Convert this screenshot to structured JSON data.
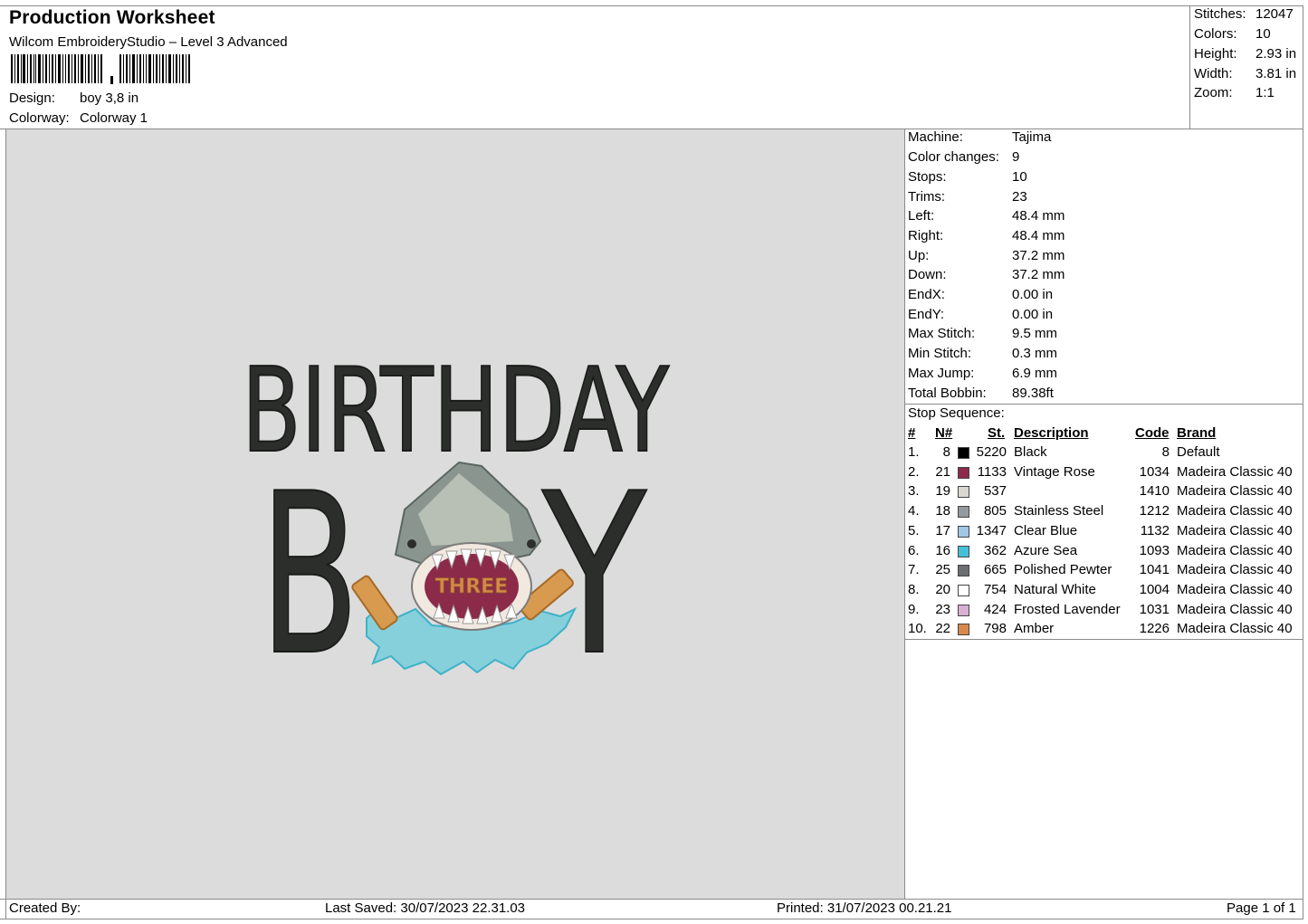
{
  "header": {
    "title": "Production Worksheet",
    "software": "Wilcom EmbroideryStudio – Level 3 Advanced",
    "design_label": "Design:",
    "design_value": "boy 3,8 in",
    "colorway_label": "Colorway:",
    "colorway_value": "Colorway 1"
  },
  "summary": [
    {
      "label": "Stitches:",
      "value": "12047"
    },
    {
      "label": "Colors:",
      "value": "10"
    },
    {
      "label": "Height:",
      "value": "2.93 in"
    },
    {
      "label": "Width:",
      "value": "3.81 in"
    },
    {
      "label": "Zoom:",
      "value": "1:1"
    }
  ],
  "design_preview": {
    "line1": "BIRTHDAY",
    "line2_left": "B",
    "line2_right": "Y",
    "inner_text": "THREE"
  },
  "machine_info": [
    {
      "label": "Machine:",
      "value": "Tajima"
    },
    {
      "label": "Color changes:",
      "value": "9"
    },
    {
      "label": "Stops:",
      "value": "10"
    },
    {
      "label": "Trims:",
      "value": "23"
    },
    {
      "label": "Left:",
      "value": "48.4 mm"
    },
    {
      "label": "Right:",
      "value": "48.4 mm"
    },
    {
      "label": "Up:",
      "value": "37.2 mm"
    },
    {
      "label": "Down:",
      "value": "37.2 mm"
    },
    {
      "label": "EndX:",
      "value": "0.00 in"
    },
    {
      "label": "EndY:",
      "value": "0.00 in"
    },
    {
      "label": "Max Stitch:",
      "value": "9.5 mm"
    },
    {
      "label": "Min Stitch:",
      "value": "0.3 mm"
    },
    {
      "label": "Max Jump:",
      "value": "6.9 mm"
    },
    {
      "label": "Total Bobbin:",
      "value": "89.38ft"
    }
  ],
  "stop_sequence": {
    "title": "Stop Sequence:",
    "columns": {
      "num": "#",
      "needle": "N#",
      "stitches": "St.",
      "description": "Description",
      "code": "Code",
      "brand": "Brand"
    },
    "rows": [
      {
        "num": "1.",
        "needle": "8",
        "color": "#000000",
        "stitches": "5220",
        "description": "Black",
        "code": "8",
        "brand": "Default"
      },
      {
        "num": "2.",
        "needle": "21",
        "color": "#8c2a4a",
        "stitches": "1133",
        "description": "Vintage Rose",
        "code": "1034",
        "brand": "Madeira Classic 40"
      },
      {
        "num": "3.",
        "needle": "19",
        "color": "#d8d8d0",
        "stitches": "537",
        "description": "",
        "code": "1410",
        "brand": "Madeira Classic 40"
      },
      {
        "num": "4.",
        "needle": "18",
        "color": "#939ba0",
        "stitches": "805",
        "description": "Stainless Steel",
        "code": "1212",
        "brand": "Madeira Classic 40"
      },
      {
        "num": "5.",
        "needle": "17",
        "color": "#9ec8e4",
        "stitches": "1347",
        "description": "Clear Blue",
        "code": "1132",
        "brand": "Madeira Classic 40"
      },
      {
        "num": "6.",
        "needle": "16",
        "color": "#45c0d8",
        "stitches": "362",
        "description": "Azure Sea",
        "code": "1093",
        "brand": "Madeira Classic 40"
      },
      {
        "num": "7.",
        "needle": "25",
        "color": "#6b6e72",
        "stitches": "665",
        "description": "Polished Pewter",
        "code": "1041",
        "brand": "Madeira Classic 40"
      },
      {
        "num": "8.",
        "needle": "20",
        "color": "#ffffff",
        "stitches": "754",
        "description": "Natural White",
        "code": "1004",
        "brand": "Madeira Classic 40"
      },
      {
        "num": "9.",
        "needle": "23",
        "color": "#d8b0d4",
        "stitches": "424",
        "description": "Frosted Lavender",
        "code": "1031",
        "brand": "Madeira Classic 40"
      },
      {
        "num": "10.",
        "needle": "22",
        "color": "#d8884a",
        "stitches": "798",
        "description": "Amber",
        "code": "1226",
        "brand": "Madeira Classic 40"
      }
    ]
  },
  "footer": {
    "created_by": "Created By:",
    "last_saved": "Last Saved: 30/07/2023 22.31.03",
    "printed": "Printed: 31/07/2023 00.21.21",
    "page": "Page 1 of 1"
  }
}
